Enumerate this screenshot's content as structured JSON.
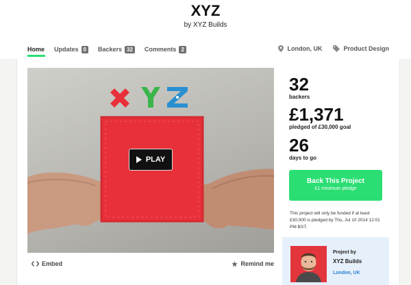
{
  "project": {
    "title": "XYZ",
    "byline": "by XYZ Builds"
  },
  "tabs": [
    {
      "label": "Home",
      "count": null,
      "active": true
    },
    {
      "label": "Updates",
      "count": "0"
    },
    {
      "label": "Backers",
      "count": "32"
    },
    {
      "label": "Comments",
      "count": "2"
    }
  ],
  "meta": {
    "location": "London, UK",
    "category": "Product Design"
  },
  "video": {
    "play_label": "PLAY",
    "logo_text": "XYZ"
  },
  "actions": {
    "embed_label": "Embed",
    "remind_label": "Remind me"
  },
  "stats": {
    "backers": "32",
    "backers_label": "backers",
    "pledged": "£1,371",
    "pledged_label": "pledged of £30,000 goal",
    "days": "26",
    "days_label": "days to go"
  },
  "back_button": {
    "label": "Back This Project",
    "sub": "£1 minimum pledge"
  },
  "funding_note": "This project will only be funded if at least £30,000 is pledged by Thu, Jul 10 2014 12:01 PM BST.",
  "creator": {
    "project_by": "Project by",
    "name": "XYZ Builds",
    "location": "London, UK"
  },
  "colors": {
    "accent_green": "#2bde73",
    "link_blue": "#2a7fd1",
    "logo_red": "#e8303a",
    "logo_green": "#3ab54a",
    "logo_blue": "#2a8fd1"
  }
}
